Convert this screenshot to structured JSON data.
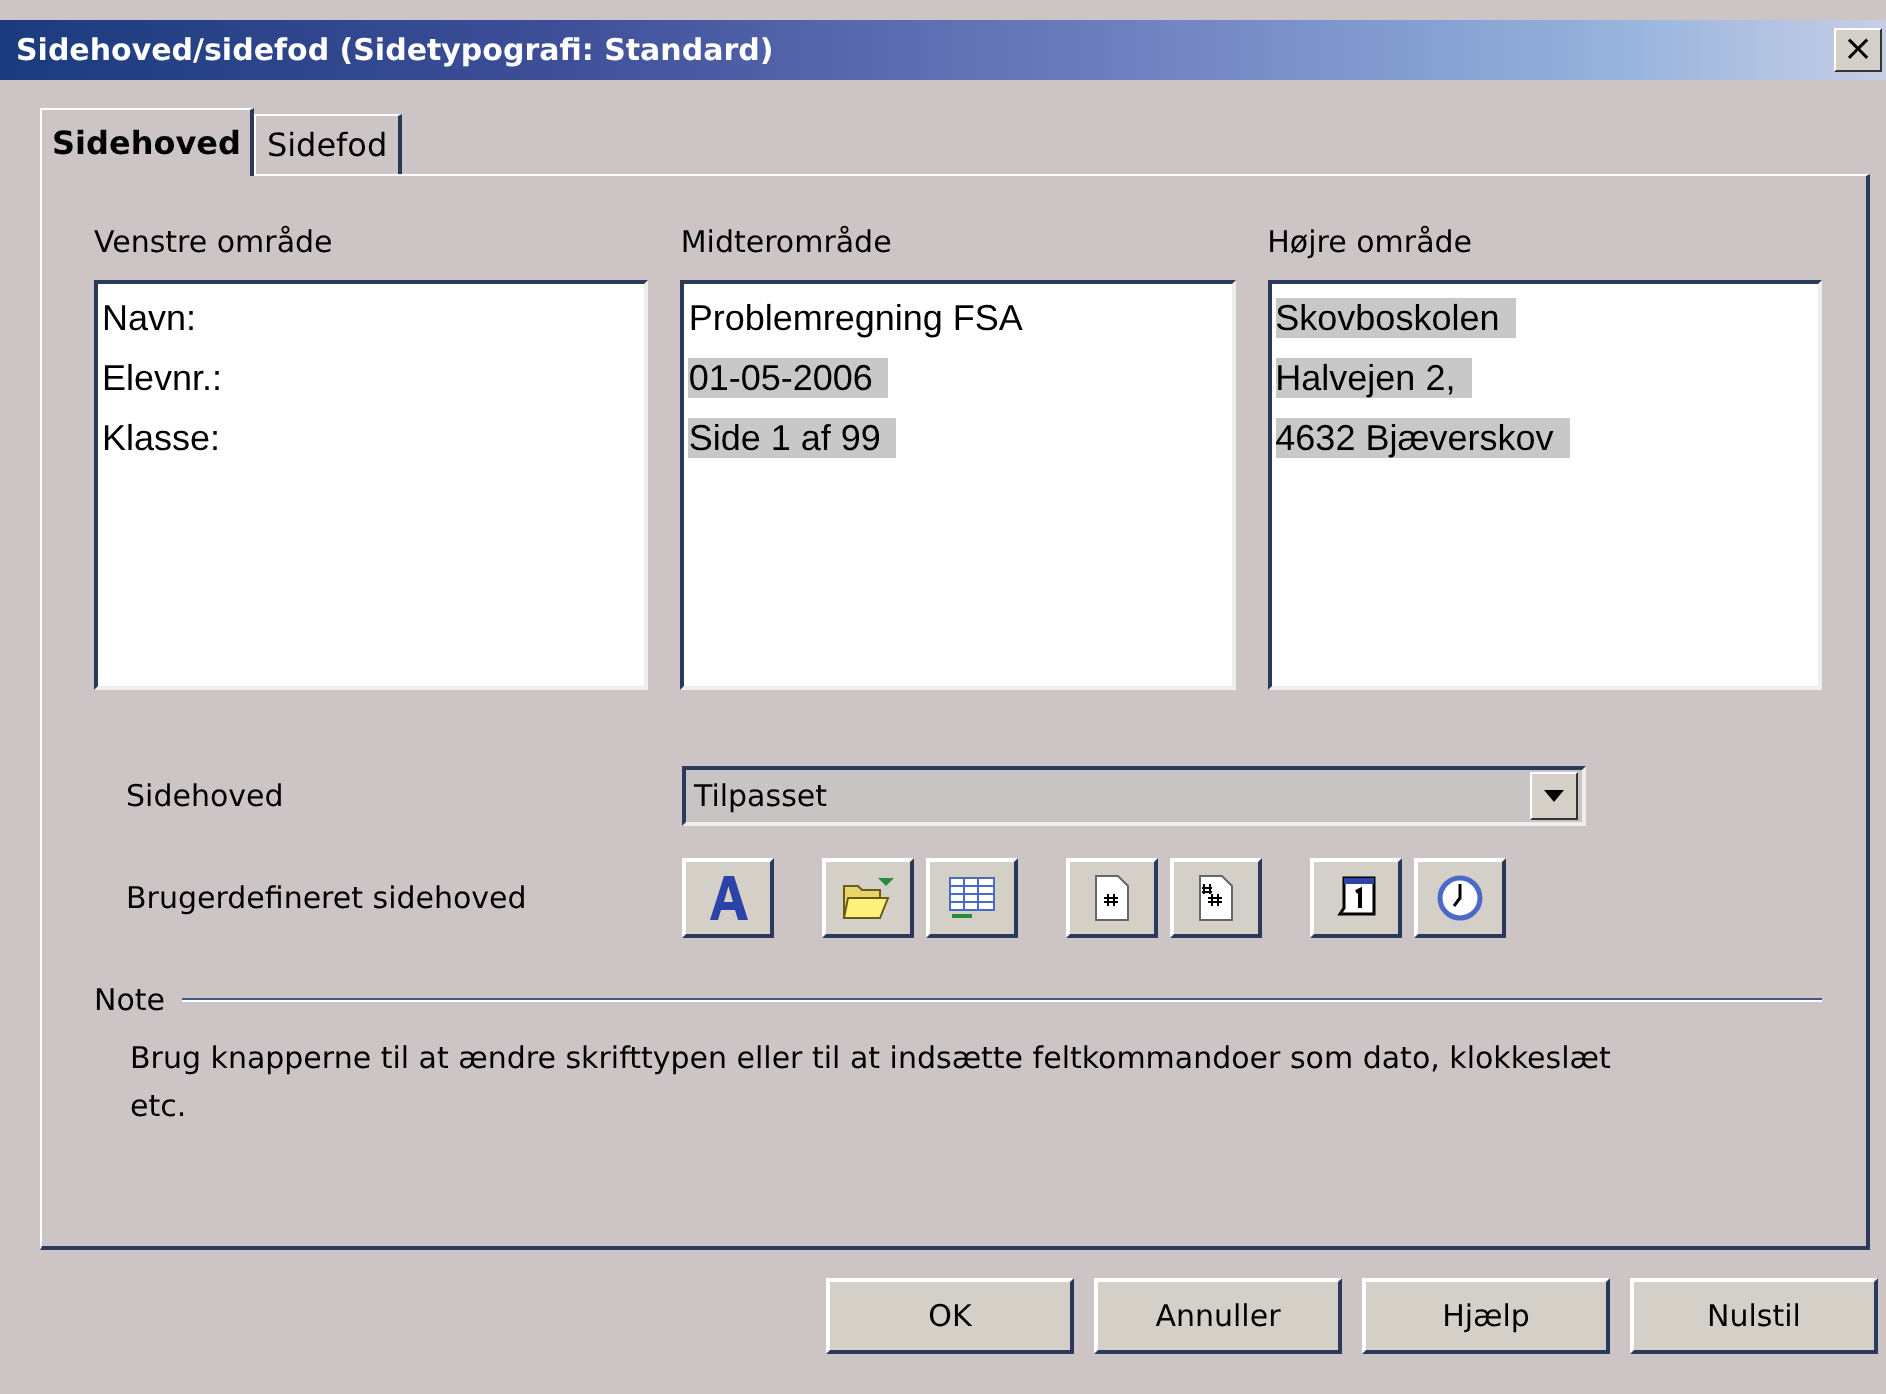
{
  "window": {
    "title": "Sidehoved/sidefod (Sidetypografi: Standard)",
    "close": "×"
  },
  "tabs": [
    {
      "label": "Sidehoved",
      "selected": true
    },
    {
      "label": "Sidefod",
      "selected": false
    }
  ],
  "areas": [
    {
      "label": "Venstre område",
      "lines": [
        {
          "text": "Navn:",
          "selected": false
        },
        {
          "text": "Elevnr.:",
          "selected": false
        },
        {
          "text": "Klasse:",
          "selected": false
        }
      ]
    },
    {
      "label": "Midterområde",
      "lines": [
        {
          "text": "Problemregning FSA",
          "selected": false
        },
        {
          "text": "01-05-2006",
          "selected": true
        },
        {
          "text": "Side 1 af 99",
          "selected": true
        }
      ]
    },
    {
      "label": "Højre område",
      "lines": [
        {
          "text": "Skovboskolen",
          "selected": true
        },
        {
          "text": "Halvejen 2,",
          "selected": true
        },
        {
          "text": "4632 Bjæverskov",
          "selected": true
        }
      ]
    }
  ],
  "header_select": {
    "label": "Sidehoved",
    "value": "Tilpasset"
  },
  "custom": {
    "label": "Brugerdefineret sidehoved",
    "buttons": [
      {
        "kind": "font"
      },
      {
        "kind": "file"
      },
      {
        "kind": "table"
      },
      {
        "kind": "page"
      },
      {
        "kind": "pages"
      },
      {
        "kind": "date"
      },
      {
        "kind": "time"
      }
    ]
  },
  "note": {
    "title": "Note",
    "text": "Brug knapperne til at ændre skrifttypen eller til at indsætte feltkommandoer som dato, klokkeslæt etc."
  },
  "buttons": [
    "OK",
    "Annuller",
    "Hjælp",
    "Nulstil"
  ]
}
